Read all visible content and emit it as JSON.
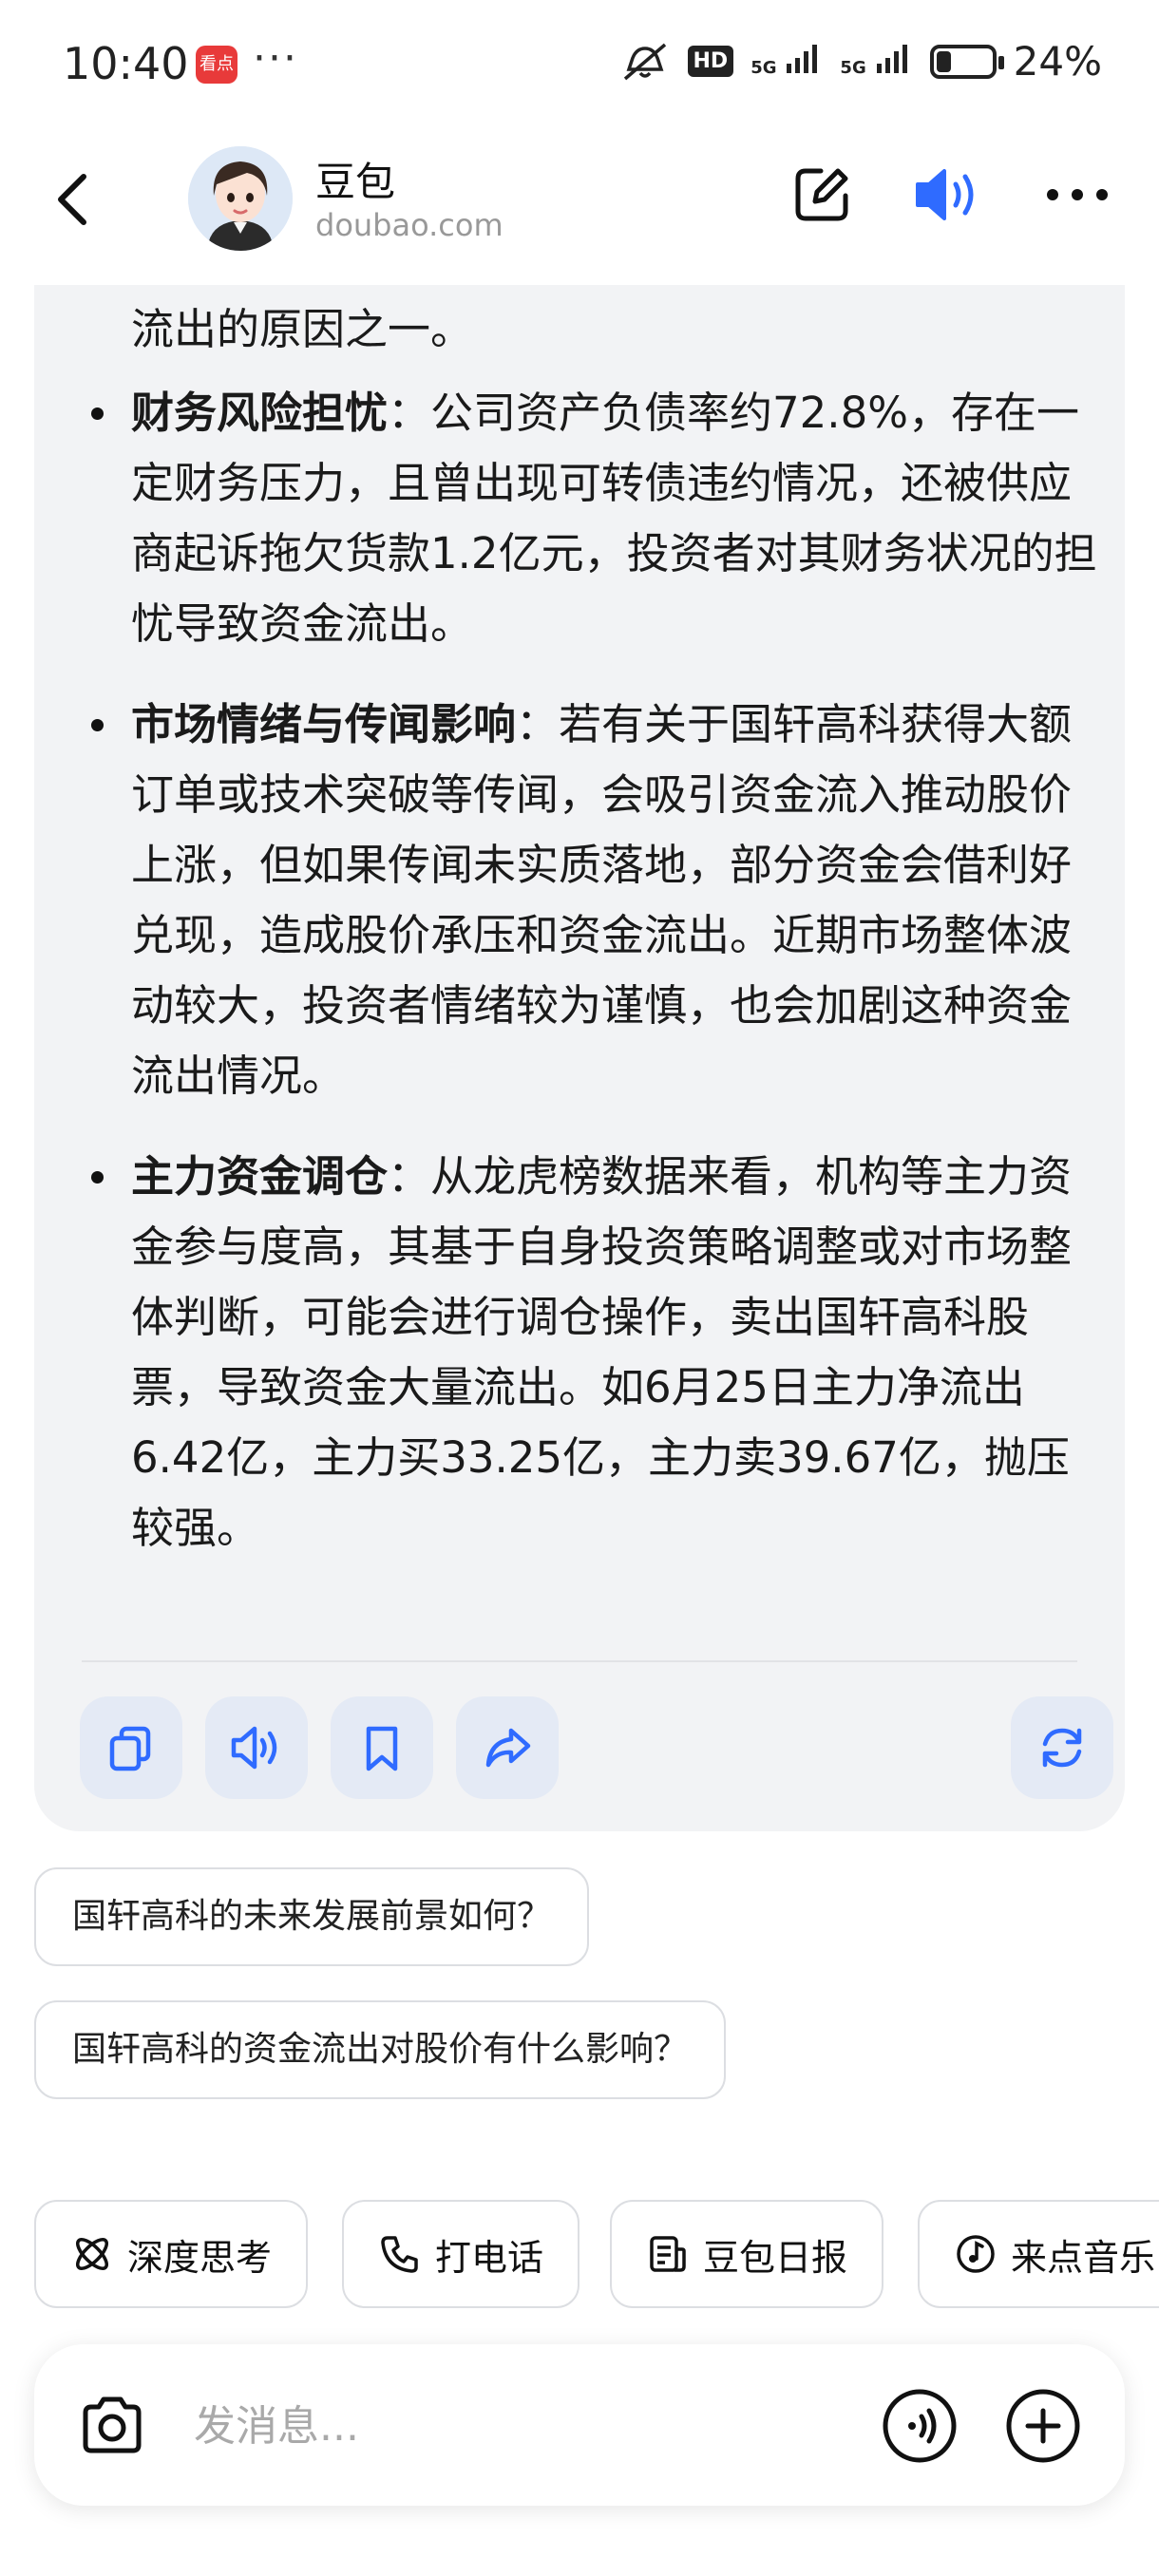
{
  "status_bar": {
    "time": "10:40",
    "app_badge": "看点",
    "more": "···",
    "hd": "HD",
    "signal1": "5G",
    "signal2": "5G",
    "battery_level": 0.24,
    "battery_pct": "24%"
  },
  "header": {
    "title": "豆包",
    "subtitle": "doubao.com"
  },
  "message": {
    "first_line": "流出的原因之一。",
    "bullets": [
      {
        "bold": "财务风险担忧",
        "text": "：公司资产负债率约72.8%，存在一定财务压力，且曾出现可转债违约情况，还被供应商起诉拖欠货款1.2亿元，投资者对其财务状况的担忧导致资金流出。"
      },
      {
        "bold": "市场情绪与传闻影响",
        "text": "：若有关于国轩高科获得大额订单或技术突破等传闻，会吸引资金流入推动股价上涨，但如果传闻未实质落地，部分资金会借利好兑现，造成股价承压和资金流出。近期市场整体波动较大，投资者情绪较为谨慎，也会加剧这种资金流出情况。"
      },
      {
        "bold": "主力资金调仓",
        "text": "：从龙虎榜数据来看，机构等主力资金参与度高，其基于自身投资策略调整或对市场整体判断，可能会进行调仓操作，卖出国轩高科股票，导致资金大量流出。如6月25日主力净流出6.42亿，主力买33.25亿，主力卖39.67亿，抛压较强。"
      }
    ],
    "actions": [
      "copy-icon",
      "read-aloud-icon",
      "bookmark-icon",
      "share-icon",
      "regenerate-icon"
    ]
  },
  "suggestions": [
    "国轩高科的未来发展前景如何？",
    "国轩高科的资金流出对股价有什么影响？"
  ],
  "tools": [
    {
      "label": "深度思考",
      "icon": "atom-icon"
    },
    {
      "label": "打电话",
      "icon": "phone-icon"
    },
    {
      "label": "豆包日报",
      "icon": "news-icon"
    },
    {
      "label": "来点音乐",
      "icon": "music-icon"
    }
  ],
  "input": {
    "placeholder": "发消息..."
  },
  "colors": {
    "accent": "#2f6bff",
    "bubble_bg": "#f2f3f5",
    "action_bg": "#e4eaf5"
  }
}
